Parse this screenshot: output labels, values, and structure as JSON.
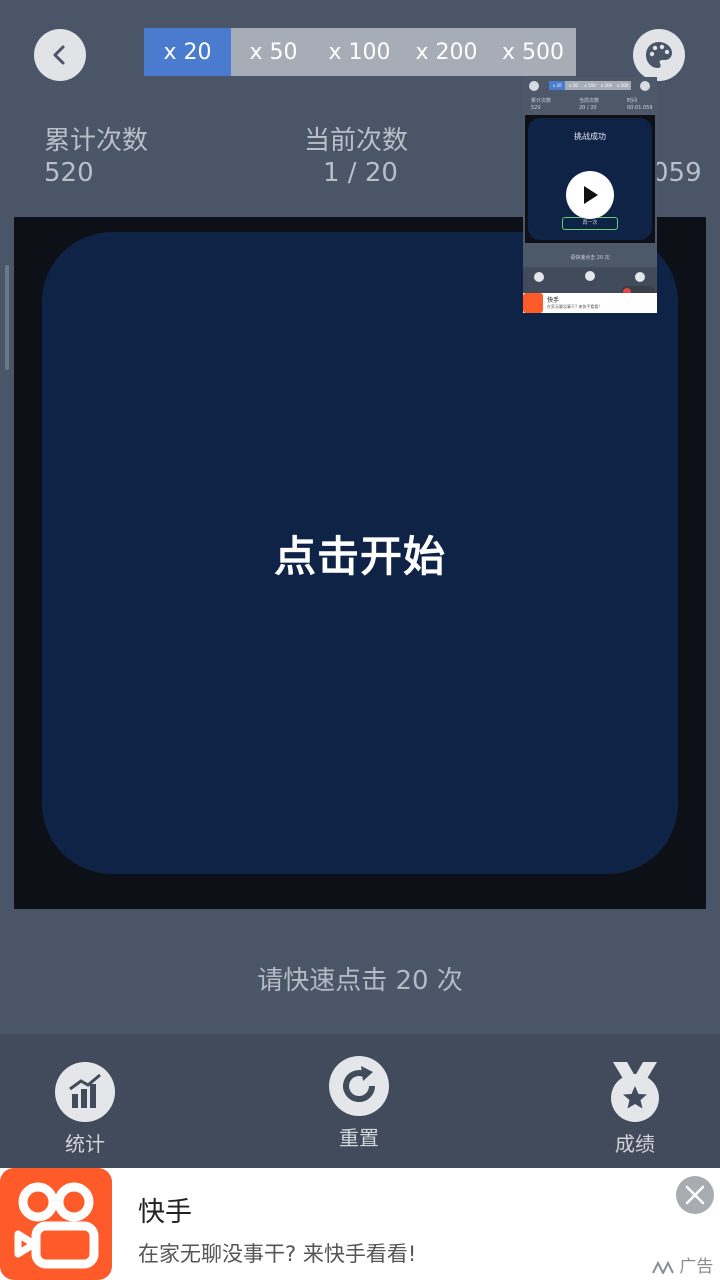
{
  "header": {
    "multipliers": [
      "x 20",
      "x 50",
      "x 100",
      "x 200",
      "x 500"
    ],
    "active_index": 0,
    "back_icon": "chevron-left-icon",
    "theme_icon": "palette-icon"
  },
  "stats": {
    "total_label": "累计次数",
    "total_value": "520",
    "current_label": "当前次数",
    "current_value": "1 / 20",
    "third_value_partial": "059"
  },
  "game": {
    "start_text": "点击开始"
  },
  "hint": "请快速点击 20 次",
  "nav": {
    "stats_label": "统计",
    "reset_label": "重置",
    "score_label": "成绩"
  },
  "ad": {
    "title": "快手",
    "desc": "在家无聊没事干? 来快手看看!",
    "tag": "广告",
    "close_icon": "close-icon"
  },
  "thumbnail": {
    "multipliers": [
      "x 20",
      "x 50",
      "x 100",
      "x 200",
      "x 500"
    ],
    "stat1_label": "累计次数",
    "stat1_value": "520",
    "stat2_label": "当前次数",
    "stat2_value": "20 / 20",
    "stat3_label": "时间",
    "stat3_value": "00:01.059",
    "title": "挑战成功",
    "button": "再一次",
    "hint": "请快速点击 20 次",
    "ad_title": "快手",
    "ad_desc": "在家无聊没事干? 来快手看看!"
  },
  "colors": {
    "background": "#4a5567",
    "accent": "#4b7bcf",
    "pad": "#0f2347",
    "ad_brand": "#fe5a2a"
  }
}
